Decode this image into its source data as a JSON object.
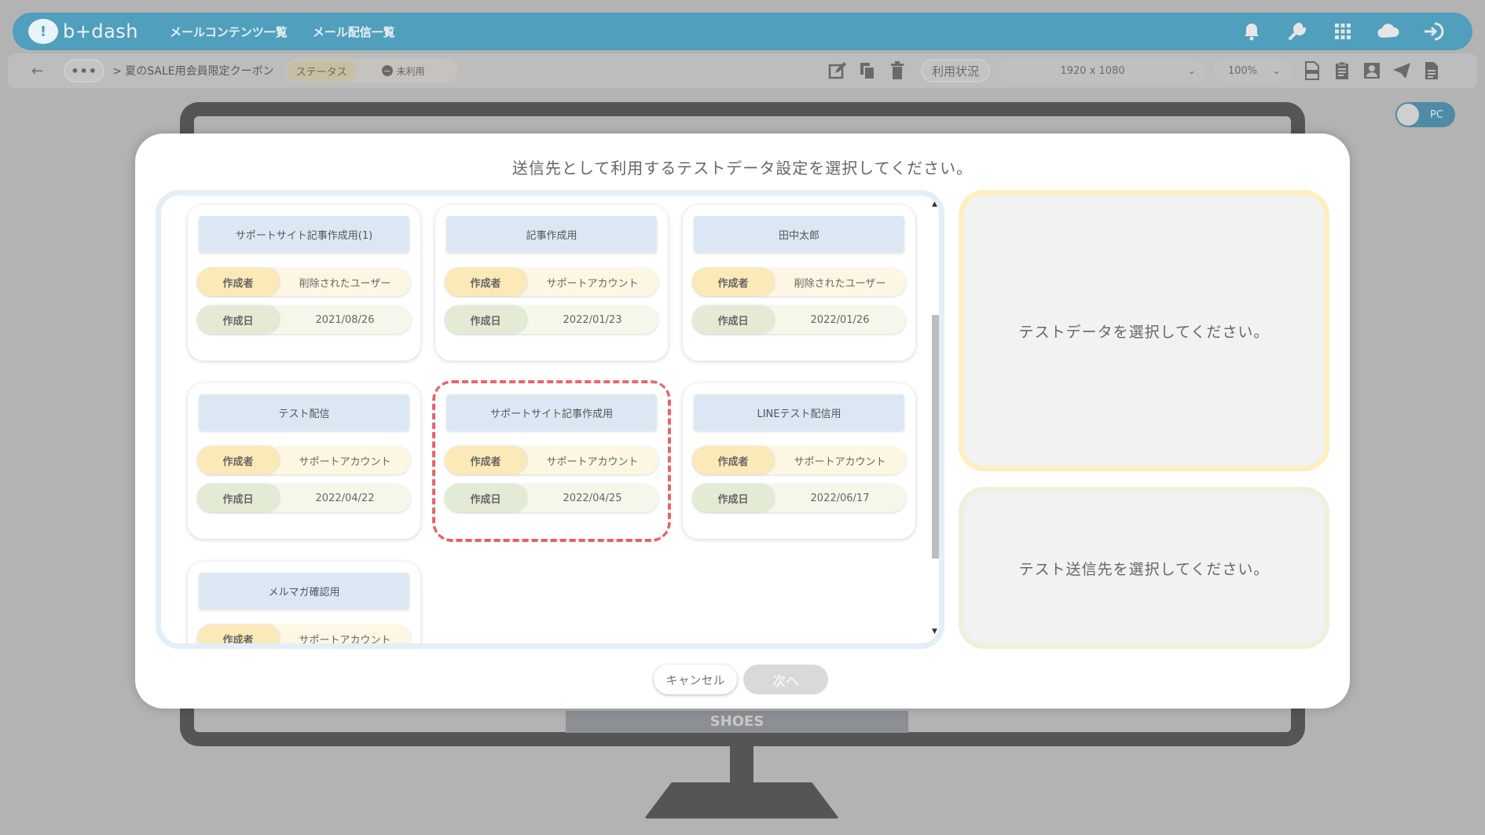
{
  "header": {
    "logo_text": "b+dash",
    "nav": [
      "メールコンテンツ一覧",
      "メール配信一覧"
    ],
    "icons": [
      "bell-icon",
      "wrench-icon",
      "grid-icon",
      "cloud-icon",
      "logout-icon"
    ]
  },
  "toolbar": {
    "dots": "•••",
    "breadcrumb": "> 夏のSALE用会員限定クーポン",
    "status_label": "ステータス",
    "status_value": "未利用",
    "usage_label": "利用状況",
    "resolution": "1920 x 1080",
    "zoom": "100%"
  },
  "pc_toggle": "PC",
  "background_banner": "SHOES",
  "modal": {
    "title": "送信先として利用するテストデータ設定を選択してください。",
    "author_label": "作成者",
    "date_label": "作成日",
    "cards": [
      {
        "title": "サポートサイト記事作成用(1)",
        "author": "削除されたユーザー",
        "date": "2021/08/26"
      },
      {
        "title": "記事作成用",
        "author": "サポートアカウント",
        "date": "2022/01/23"
      },
      {
        "title": "田中太郎",
        "author": "削除されたユーザー",
        "date": "2022/01/26"
      },
      {
        "title": "テスト配信",
        "author": "サポートアカウント",
        "date": "2022/04/22"
      },
      {
        "title": "サポートサイト記事作成用",
        "author": "サポートアカウント",
        "date": "2022/04/25"
      },
      {
        "title": "LINEテスト配信用",
        "author": "サポートアカウント",
        "date": "2022/06/17"
      },
      {
        "title": "メルマガ確認用",
        "author": "サポートアカウント",
        "date": ""
      }
    ],
    "data_panel_text": "テストデータを選択してください。",
    "dest_panel_text": "テスト送信先を選択してください。",
    "cancel_label": "キャンセル",
    "next_label": "次へ"
  }
}
